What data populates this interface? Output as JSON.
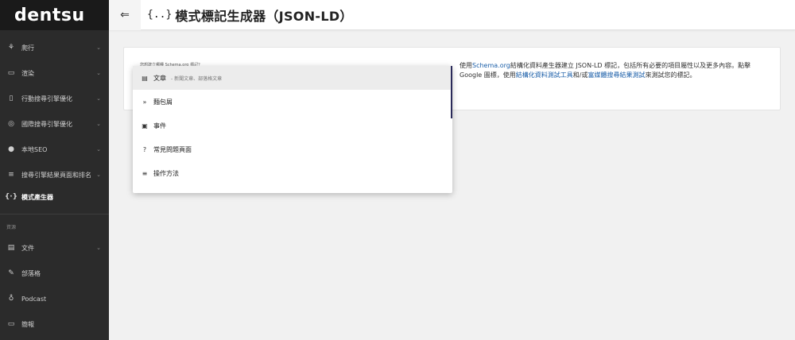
{
  "logo": "dentsu",
  "sidebar": {
    "items": [
      {
        "label": "爬行",
        "icon": "crawler-icon",
        "glyph": "⚘",
        "has_chevron": true
      },
      {
        "label": "渲染",
        "icon": "render-icon",
        "glyph": "▭",
        "has_chevron": true
      },
      {
        "label": "行動搜尋引擎優化",
        "icon": "mobile-icon",
        "glyph": "▯",
        "has_chevron": true
      },
      {
        "label": "國際搜尋引擎優化",
        "icon": "globe-icon",
        "glyph": "◎",
        "has_chevron": true
      },
      {
        "label": "本地SEO",
        "icon": "location-icon",
        "glyph": "●",
        "has_chevron": true
      },
      {
        "label": "搜尋引擎結果頁面和排名",
        "icon": "list-icon",
        "glyph": "≡",
        "has_chevron": true
      },
      {
        "label": "模式產生器",
        "icon": "code-icon",
        "glyph": "{·}",
        "has_chevron": false,
        "active": true
      }
    ],
    "section_label": "資源",
    "resources": [
      {
        "label": "文件",
        "icon": "document-icon",
        "glyph": "▤",
        "has_chevron": true
      },
      {
        "label": "部落格",
        "icon": "pencil-icon",
        "glyph": "✎",
        "has_chevron": false
      },
      {
        "label": "Podcast",
        "icon": "microphone-icon",
        "glyph": "♁",
        "has_chevron": false
      },
      {
        "label": "簡報",
        "icon": "presentation-icon",
        "glyph": "▭",
        "has_chevron": false
      }
    ]
  },
  "header": {
    "toggle_glyph": "⇐",
    "title_icon": "{..}",
    "title": "模式標記生成器（JSON-LD）"
  },
  "form": {
    "select_label": "您想建立哪種 Schema.org 標記？"
  },
  "description": {
    "part1": "使用",
    "link1": "Schema.org",
    "part2": "結構化資料產生器建立 JSON-LD 標記，包括所有必要的項目屬性以及更多內容。點擊 Google 圖標，使用",
    "link2": "結構化資料測試工具",
    "part3": "和/或",
    "link3": "富媒體搜尋結果測試",
    "part4": "來測試您的標記。"
  },
  "dropdown": {
    "options": [
      {
        "label": "文章",
        "sub": "- 新聞文章、部落格文章",
        "icon": "article-icon",
        "glyph": "▤",
        "selected": true
      },
      {
        "label": "麵包屑",
        "sub": "",
        "icon": "breadcrumb-icon",
        "glyph": "»",
        "selected": false
      },
      {
        "label": "事件",
        "sub": "",
        "icon": "calendar-icon",
        "glyph": "▣",
        "selected": false
      },
      {
        "label": "常見問題頁面",
        "sub": "",
        "icon": "question-icon",
        "glyph": "?",
        "selected": false
      },
      {
        "label": "操作方法",
        "sub": "",
        "icon": "howto-icon",
        "glyph": "≡",
        "selected": false
      }
    ]
  }
}
